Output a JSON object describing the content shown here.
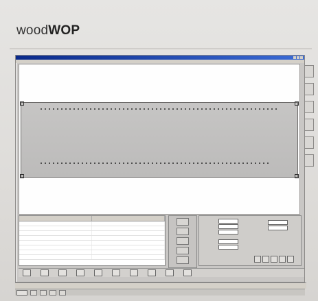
{
  "brand": {
    "prefix": "wood",
    "suffix": "WOP"
  },
  "window": {
    "title": "",
    "menu": []
  },
  "lower": {
    "grid": {
      "columns": [
        "",
        ""
      ],
      "rows": [
        [
          "",
          ""
        ],
        [
          "",
          ""
        ],
        [
          "",
          ""
        ],
        [
          "",
          ""
        ],
        [
          "",
          ""
        ],
        [
          "",
          ""
        ],
        [
          "",
          ""
        ],
        [
          "",
          ""
        ]
      ]
    },
    "form": {
      "fields": [
        {
          "label": "",
          "value": ""
        },
        {
          "label": "",
          "value": ""
        },
        {
          "label": "",
          "value": ""
        },
        {
          "label": "",
          "value": ""
        },
        {
          "label": "",
          "value": ""
        }
      ],
      "right_fields": [
        {
          "label": "",
          "value": ""
        },
        {
          "label": "",
          "value": ""
        }
      ]
    }
  },
  "statusbar": {
    "text": ""
  },
  "taskbar": {
    "items": [
      "",
      "",
      "",
      ""
    ],
    "tray": ""
  },
  "colors": {
    "titlebar": "#0b2a8a",
    "panel": "#bcbbba",
    "canvas": "#fefefe"
  }
}
